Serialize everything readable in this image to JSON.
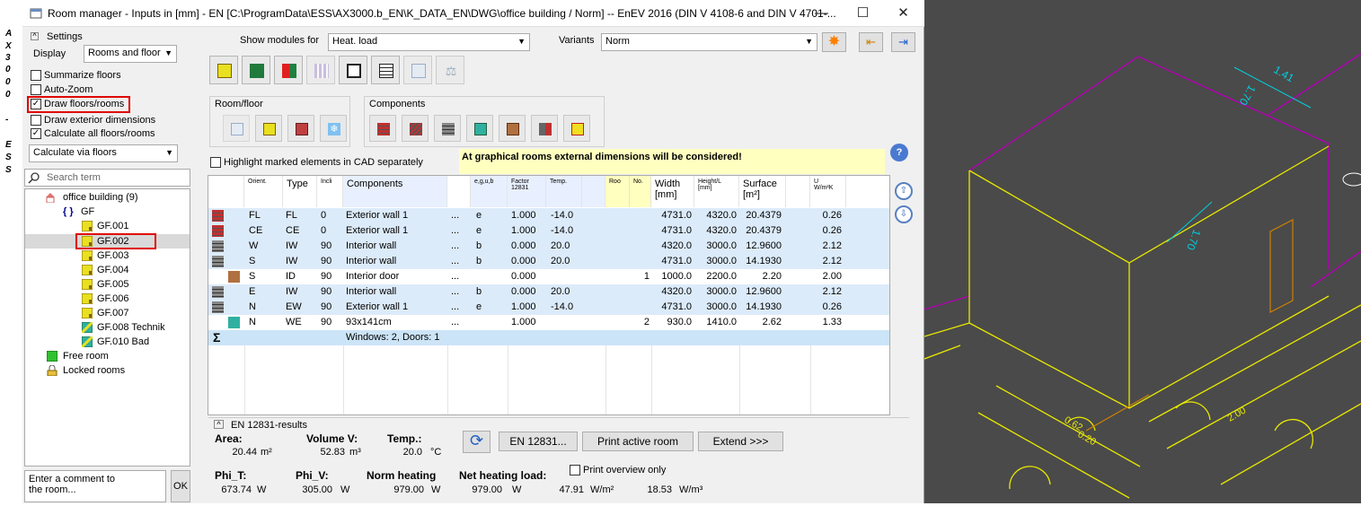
{
  "vertical_strip": {
    "letters": [
      "A",
      "X",
      "3",
      "0",
      "0",
      "0",
      "-",
      "E",
      "S",
      "S"
    ]
  },
  "window": {
    "title": "Room manager - Inputs in [mm] - EN [C:\\ProgramData\\ESS\\AX3000.b_EN\\K_DATA_EN\\DWG\\office building / Norm] -- EnEV 2016 (DIN V 4108-6 and DIN V 4701-...",
    "minimize": "—",
    "maximize": "☐",
    "close": "✕"
  },
  "settings": {
    "title": "Settings",
    "display_label": "Display",
    "display_value": "Rooms and floor",
    "checkboxes": [
      {
        "label": "Summarize floors",
        "checked": false
      },
      {
        "label": "Auto-Zoom",
        "checked": false
      },
      {
        "label": "Draw floors/rooms",
        "checked": true
      },
      {
        "label": "Draw exterior dimensions",
        "checked": false
      },
      {
        "label": "Calculate all floors/rooms",
        "checked": true
      }
    ],
    "calc_mode": "Calculate via floors",
    "search_placeholder": "Search term"
  },
  "tree": {
    "root": "office building (9)",
    "floor": "GF",
    "rooms": [
      "GF.001",
      "GF.002",
      "GF.003",
      "GF.004",
      "GF.005",
      "GF.006",
      "GF.007",
      "GF.008 Technik",
      "GF.010 Bad"
    ],
    "free_room": "Free room",
    "locked_rooms": "Locked rooms"
  },
  "comment": {
    "placeholder": "Enter a comment to the room...",
    "ok": "OK"
  },
  "toolbar": {
    "show_modules_label": "Show modules for",
    "module": "Heat. load",
    "variants_label": "Variants",
    "variant": "Norm"
  },
  "groups": {
    "room_floor": "Room/floor",
    "components": "Components"
  },
  "help_icon": "?",
  "highlight_label": "Highlight marked elements in CAD separately",
  "notice": "At graphical rooms external dimensions will be considered!",
  "table": {
    "headers": {
      "orient": "Orient.",
      "type": "Type",
      "incl": "Incli",
      "components": "Components",
      "egub": "e,g,u,b",
      "factor_a": "Factor",
      "factor_b": "12831",
      "temp": "Temp.",
      "roo": "Roo",
      "no": "No.",
      "width_a": "Width",
      "width_b": "[mm]",
      "height_a": "Height/L",
      "height_b": "[mm]",
      "surface_a": "Surface",
      "surface_b": "[m²]",
      "u_a": "U",
      "u_b": "W/m²K"
    },
    "rows": [
      {
        "orient": "FL",
        "type": "FL",
        "incl": "0",
        "comp": "Exterior wall 1",
        "dots": "...",
        "egub": "e",
        "factor": "1.000",
        "temp": "-14.0",
        "no": "",
        "width": "4731.0",
        "height": "4320.0",
        "surface": "20.4379",
        "u": "0.26"
      },
      {
        "orient": "CE",
        "type": "CE",
        "incl": "0",
        "comp": "Exterior wall 1",
        "dots": "...",
        "egub": "e",
        "factor": "1.000",
        "temp": "-14.0",
        "no": "",
        "width": "4731.0",
        "height": "4320.0",
        "surface": "20.4379",
        "u": "0.26"
      },
      {
        "orient": "W",
        "type": "IW",
        "incl": "90",
        "comp": "Interior wall",
        "dots": "...",
        "egub": "b",
        "factor": "0.000",
        "temp": "20.0",
        "no": "",
        "width": "4320.0",
        "height": "3000.0",
        "surface": "12.9600",
        "u": "2.12"
      },
      {
        "orient": "S",
        "type": "IW",
        "incl": "90",
        "comp": "Interior wall",
        "dots": "...",
        "egub": "b",
        "factor": "0.000",
        "temp": "20.0",
        "no": "",
        "width": "4731.0",
        "height": "3000.0",
        "surface": "14.1930",
        "u": "2.12"
      },
      {
        "orient": "S",
        "type": "ID",
        "incl": "90",
        "comp": "Interior door",
        "dots": "...",
        "egub": "",
        "factor": "0.000",
        "temp": "",
        "no": "1",
        "width": "1000.0",
        "height": "2200.0",
        "surface": "2.20",
        "u": "2.00"
      },
      {
        "orient": "E",
        "type": "IW",
        "incl": "90",
        "comp": "Interior wall",
        "dots": "...",
        "egub": "b",
        "factor": "0.000",
        "temp": "20.0",
        "no": "",
        "width": "4320.0",
        "height": "3000.0",
        "surface": "12.9600",
        "u": "2.12"
      },
      {
        "orient": "N",
        "type": "EW",
        "incl": "90",
        "comp": "Exterior wall 1",
        "dots": "...",
        "egub": "e",
        "factor": "1.000",
        "temp": "-14.0",
        "no": "",
        "width": "4731.0",
        "height": "3000.0",
        "surface": "14.1930",
        "u": "0.26"
      },
      {
        "orient": "N",
        "type": "WE",
        "incl": "90",
        "comp": "93x141cm",
        "dots": "...",
        "egub": "",
        "factor": "1.000",
        "temp": "",
        "no": "2",
        "width": "930.0",
        "height": "1410.0",
        "surface": "2.62",
        "u": "1.33"
      }
    ],
    "sum_symbol": "Σ",
    "sum_text": "Windows: 2, Doors: 1"
  },
  "results": {
    "section_title": "EN 12831-results",
    "area_label": "Area:",
    "area_value": "20.44",
    "area_unit": "m²",
    "volume_label": "Volume V:",
    "volume_value": "52.83",
    "volume_unit": "m³",
    "temp_label": "Temp.:",
    "temp_value": "20.0",
    "temp_unit": "°C",
    "phi_t_label": "Phi_T:",
    "phi_t_value": "673.74",
    "phi_t_unit": "W",
    "phi_v_label": "Phi_V:",
    "phi_v_value": "305.00",
    "phi_v_unit": "W",
    "norm_label": "Norm heating",
    "norm_value": "979.00",
    "norm_unit": "W",
    "net_label": "Net heating load:",
    "net_value": "979.00",
    "net_unit": "W",
    "wm2_value": "47.91",
    "wm2_unit": "W/m²",
    "wm3_value": "18.53",
    "wm3_unit": "W/m³",
    "btn_en": "EN 12831...",
    "btn_print": "Print active room",
    "btn_extend": "Extend >>>",
    "print_overview": "Print overview only"
  },
  "cad": {
    "labels": [
      "1.41",
      "1.70",
      "0.62",
      "0.20",
      "2.00",
      "1.70"
    ],
    "colors": {
      "background": "#4a4a4a",
      "yellow": "#e8e800",
      "magenta": "#b000b0",
      "cyan": "#00d0e0",
      "orange": "#d08000",
      "white": "#ffffff"
    }
  }
}
